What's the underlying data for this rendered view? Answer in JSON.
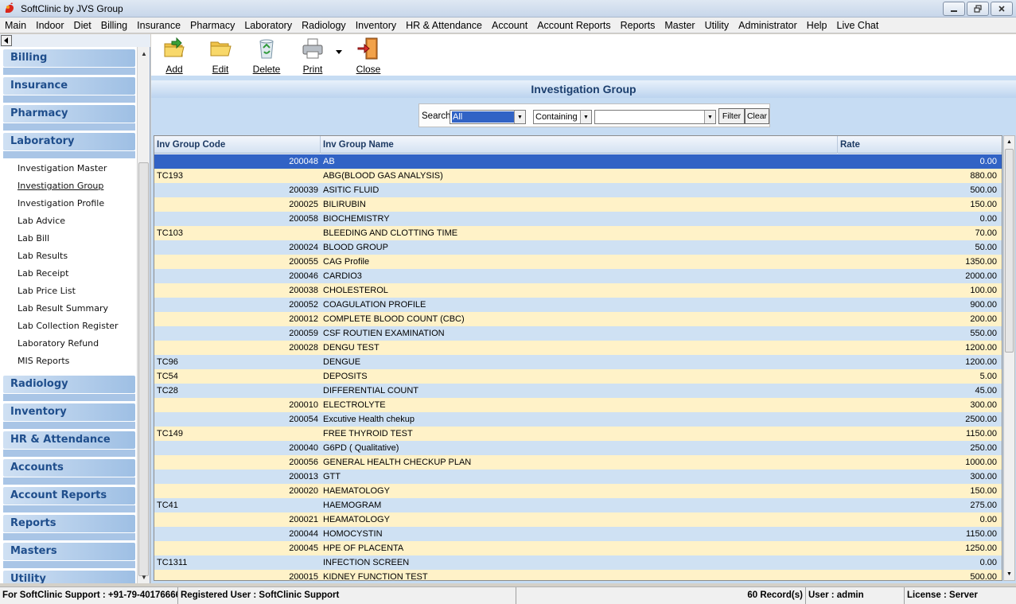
{
  "window": {
    "title": "SoftClinic by JVS Group",
    "app_icon": "softclinic-logo-icon",
    "controls": [
      "minimize-icon",
      "restore-icon",
      "close-icon"
    ]
  },
  "menu": [
    "Main",
    "Indoor",
    "Diet",
    "Billing",
    "Insurance",
    "Pharmacy",
    "Laboratory",
    "Radiology",
    "Inventory",
    "HR & Attendance",
    "Account",
    "Account Reports",
    "Reports",
    "Master",
    "Utility",
    "Administrator",
    "Help",
    "Live Chat"
  ],
  "sidebar": {
    "collapse_icon": "triangle-left-icon",
    "categories_before": [
      "Billing",
      "Insurance",
      "Pharmacy"
    ],
    "expanded": {
      "label": "Laboratory",
      "items": [
        "Investigation Master",
        "Investigation Group",
        "Investigation Profile",
        "Lab Advice",
        "Lab Bill",
        "Lab Results",
        "Lab Receipt",
        "Lab Price List",
        "Lab Result Summary",
        "Lab Collection Register",
        "Laboratory Refund",
        "MIS Reports"
      ],
      "active_index": 1
    },
    "categories_after": [
      "Radiology",
      "Inventory",
      "HR & Attendance",
      "Accounts",
      "Account Reports",
      "Reports",
      "Masters",
      "Utility"
    ]
  },
  "toolbar": {
    "add": "Add",
    "edit": "Edit",
    "delete": "Delete",
    "print": "Print",
    "close": "Close",
    "icons": [
      "folder-add-icon",
      "folder-open-icon",
      "recycle-bin-icon",
      "printer-icon",
      "exit-door-icon"
    ]
  },
  "form": {
    "title": "Investigation Group",
    "search": {
      "label": "Search",
      "field_value": "All",
      "mode_value": "Containing",
      "text_value": "",
      "filter_label": "Filter",
      "clear_label": "Clear"
    }
  },
  "grid": {
    "columns": [
      "Inv Group Code",
      "Inv Group Name",
      "Rate"
    ],
    "selected_row": 0,
    "rows": [
      {
        "code": "200048",
        "name": "AB",
        "rate": "0.00"
      },
      {
        "code": "TC193",
        "name": "ABG(BLOOD GAS ANALYSIS)",
        "rate": "880.00"
      },
      {
        "code": "200039",
        "name": "ASITIC FLUID",
        "rate": "500.00"
      },
      {
        "code": "200025",
        "name": "BILIRUBIN",
        "rate": "150.00"
      },
      {
        "code": "200058",
        "name": "BIOCHEMISTRY",
        "rate": "0.00"
      },
      {
        "code": "TC103",
        "name": "BLEEDING AND CLOTTING TIME",
        "rate": "70.00"
      },
      {
        "code": "200024",
        "name": "BLOOD GROUP",
        "rate": "50.00"
      },
      {
        "code": "200055",
        "name": "CAG Profile",
        "rate": "1350.00"
      },
      {
        "code": "200046",
        "name": "CARDIO3",
        "rate": "2000.00"
      },
      {
        "code": "200038",
        "name": "CHOLESTEROL",
        "rate": "100.00"
      },
      {
        "code": "200052",
        "name": "COAGULATION PROFILE",
        "rate": "900.00"
      },
      {
        "code": "200012",
        "name": "COMPLETE BLOOD COUNT (CBC)",
        "rate": "200.00"
      },
      {
        "code": "200059",
        "name": "CSF ROUTIEN  EXAMINATION",
        "rate": "550.00"
      },
      {
        "code": "200028",
        "name": "DENGU TEST",
        "rate": "1200.00"
      },
      {
        "code": "TC96",
        "name": "DENGUE",
        "rate": "1200.00"
      },
      {
        "code": "TC54",
        "name": "DEPOSITS",
        "rate": "5.00"
      },
      {
        "code": "TC28",
        "name": "DIFFERENTIAL COUNT",
        "rate": "45.00"
      },
      {
        "code": "200010",
        "name": "ELECTROLYTE",
        "rate": "300.00"
      },
      {
        "code": "200054",
        "name": "Excutive Health chekup",
        "rate": "2500.00"
      },
      {
        "code": "TC149",
        "name": "FREE THYROID TEST",
        "rate": "1150.00"
      },
      {
        "code": "200040",
        "name": "G6PD ( Qualitative)",
        "rate": "250.00"
      },
      {
        "code": "200056",
        "name": "GENERAL HEALTH CHECKUP PLAN",
        "rate": "1000.00"
      },
      {
        "code": "200013",
        "name": "GTT",
        "rate": "300.00"
      },
      {
        "code": "200020",
        "name": "HAEMATOLOGY",
        "rate": "150.00"
      },
      {
        "code": "TC41",
        "name": "HAEMOGRAM",
        "rate": "275.00"
      },
      {
        "code": "200021",
        "name": "HEAMATOLOGY",
        "rate": "0.00"
      },
      {
        "code": "200044",
        "name": "HOMOCYSTIN",
        "rate": "1150.00"
      },
      {
        "code": "200045",
        "name": "HPE OF PLACENTA",
        "rate": "1250.00"
      },
      {
        "code": "TC1311",
        "name": "INFECTION SCREEN",
        "rate": "0.00"
      },
      {
        "code": "200015",
        "name": "KIDNEY FUNCTION TEST",
        "rate": "500.00"
      }
    ]
  },
  "status": {
    "support": "For SoftClinic Support : +91-79-40176666",
    "registered": "Registered User : SoftClinic Support",
    "records": "60 Record(s)",
    "user": "User : admin",
    "license": "License : Server"
  }
}
